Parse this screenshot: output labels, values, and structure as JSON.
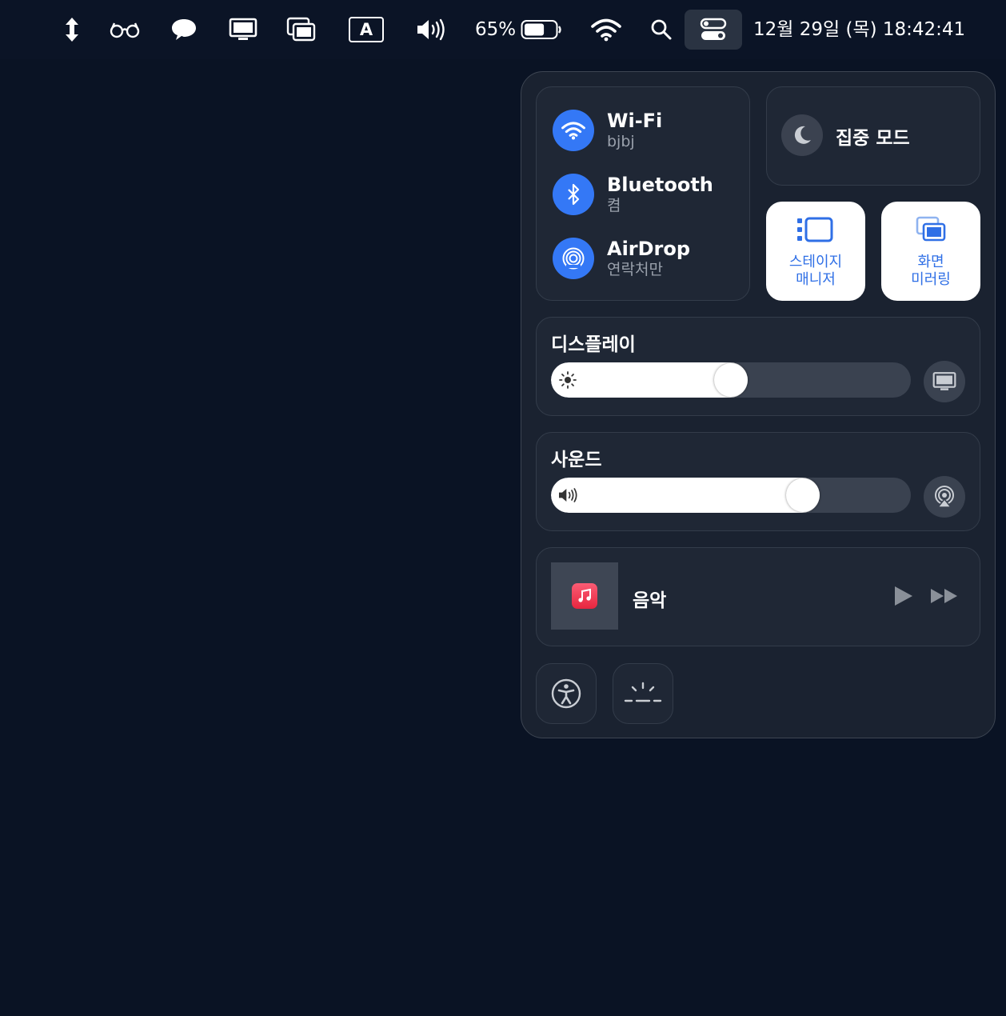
{
  "menubar": {
    "battery_percent": "65%",
    "battery_level": 0.65,
    "input_source": "A",
    "datetime": "12월 29일 (목) 18:42:41",
    "icons": [
      "scroll-arrows-icon",
      "glasses-icon",
      "speech-bubble-icon",
      "display-icon",
      "screen-mirroring-icon",
      "input-source-icon",
      "volume-icon",
      "battery-icon",
      "wifi-icon",
      "search-icon",
      "control-center-icon"
    ]
  },
  "control_center": {
    "wifi": {
      "title": "Wi-Fi",
      "subtitle": "bjbj"
    },
    "bluetooth": {
      "title": "Bluetooth",
      "subtitle": "켬"
    },
    "airdrop": {
      "title": "AirDrop",
      "subtitle": "연락처만"
    },
    "focus": {
      "label": "집중 모드"
    },
    "stage_manager": {
      "line1": "스테이지",
      "line2": "매니저"
    },
    "screen_mirroring": {
      "line1": "화면",
      "line2": "미러링"
    },
    "display": {
      "title": "디스플레이",
      "brightness_level": 0.5
    },
    "sound": {
      "title": "사운드",
      "volume_level": 0.72
    },
    "now_playing": {
      "title": "음악"
    },
    "colors": {
      "accent_blue": "#3478f6",
      "panel": "#1a2230",
      "tile": "#1f2735"
    }
  }
}
